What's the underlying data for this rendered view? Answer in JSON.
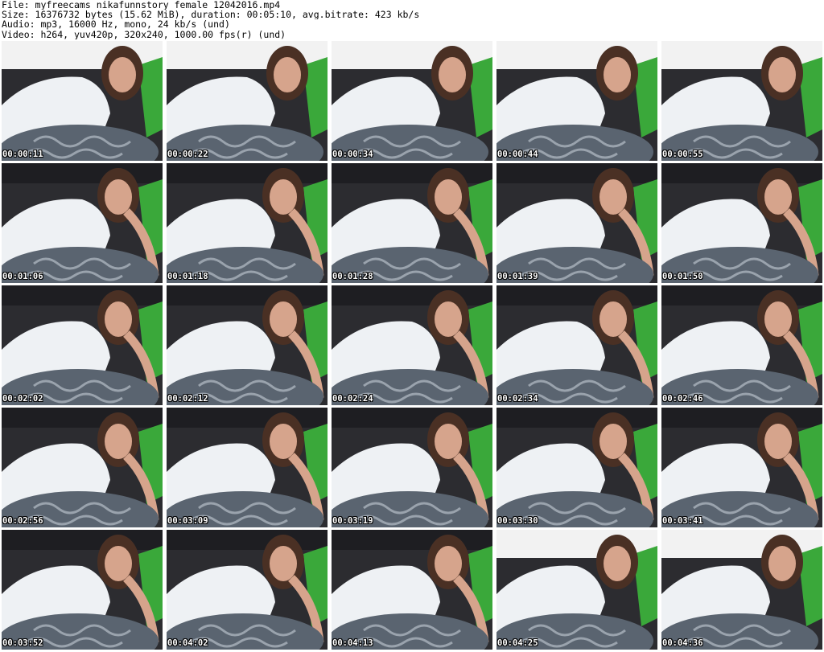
{
  "header": {
    "line1": "File: myfreecams_nikafunnstory_female_12042016.mp4",
    "line2": "Size: 16376732 bytes (15.62 MiB), duration: 00:05:10, avg.bitrate: 423 kb/s",
    "line3": "Audio: mp3, 16000 Hz, mono, 24 kb/s (und)",
    "line4": "Video: h264, yuv420p, 320x240, 1000.00 fps(r) (und)"
  },
  "colors": {
    "background": "#ffffff",
    "frame_dark": "#2c2c30",
    "cardigan": "#eef1f4",
    "pillow": "#5a6470",
    "green_cushion": "#3aa83a",
    "hair": "#4a3024",
    "skin": "#d6a48c"
  },
  "thumbnails": [
    {
      "time": "00:00:11",
      "scene": "early"
    },
    {
      "time": "00:00:22",
      "scene": "early"
    },
    {
      "time": "00:00:34",
      "scene": "early"
    },
    {
      "time": "00:00:44",
      "scene": "early"
    },
    {
      "time": "00:00:55",
      "scene": "early"
    },
    {
      "time": "00:01:06",
      "scene": "mid"
    },
    {
      "time": "00:01:18",
      "scene": "mid"
    },
    {
      "time": "00:01:28",
      "scene": "mid"
    },
    {
      "time": "00:01:39",
      "scene": "mid"
    },
    {
      "time": "00:01:50",
      "scene": "mid"
    },
    {
      "time": "00:02:02",
      "scene": "mid"
    },
    {
      "time": "00:02:12",
      "scene": "mid"
    },
    {
      "time": "00:02:24",
      "scene": "mid"
    },
    {
      "time": "00:02:34",
      "scene": "mid"
    },
    {
      "time": "00:02:46",
      "scene": "mid"
    },
    {
      "time": "00:02:56",
      "scene": "mid"
    },
    {
      "time": "00:03:09",
      "scene": "mid"
    },
    {
      "time": "00:03:19",
      "scene": "mid"
    },
    {
      "time": "00:03:30",
      "scene": "mid"
    },
    {
      "time": "00:03:41",
      "scene": "mid"
    },
    {
      "time": "00:03:52",
      "scene": "mid"
    },
    {
      "time": "00:04:02",
      "scene": "mid"
    },
    {
      "time": "00:04:13",
      "scene": "mid"
    },
    {
      "time": "00:04:25",
      "scene": "early"
    },
    {
      "time": "00:04:36",
      "scene": "early"
    }
  ]
}
